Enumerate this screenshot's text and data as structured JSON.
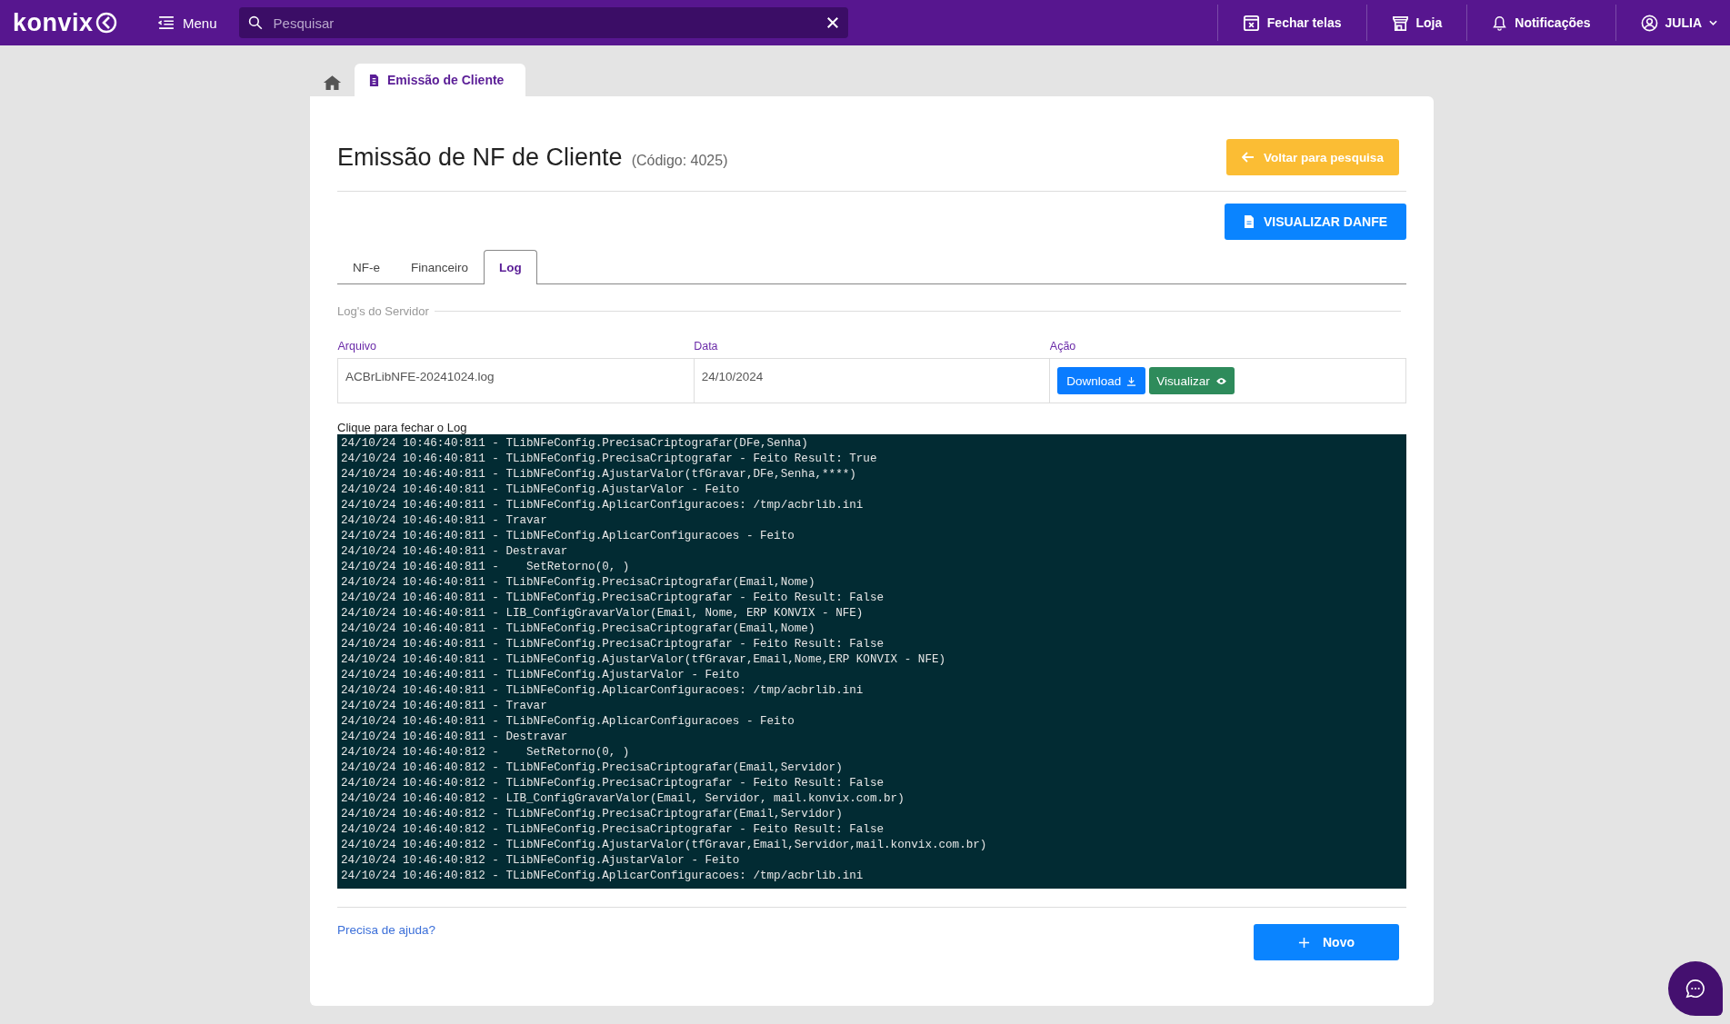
{
  "topbar": {
    "logo": "konvix",
    "menu_label": "Menu",
    "search": {
      "placeholder": "Pesquisar"
    },
    "actions": [
      {
        "kind": "close-screens",
        "label": "Fechar telas"
      },
      {
        "kind": "store",
        "label": "Loja"
      },
      {
        "kind": "bell",
        "label": "Notificações"
      },
      {
        "kind": "user",
        "label": "JULIA"
      }
    ]
  },
  "page_tabs": [
    {
      "label": "Emissão de Cliente",
      "selected": true
    }
  ],
  "title": "Emissão de NF de Cliente",
  "code": "(Código: 4025)",
  "back_button": "Voltar para pesquisa",
  "danfe_button": "VISUALIZAR DANFE",
  "tabs": [
    {
      "label": "NF-e",
      "selected": false
    },
    {
      "label": "Financeiro",
      "selected": false
    },
    {
      "label": "Log",
      "selected": true
    }
  ],
  "section_title": "Log's do Servidor",
  "table": {
    "columns": [
      "Arquivo",
      "Data",
      "Ação"
    ],
    "rows": [
      {
        "file": "ACBrLibNFE-20241024.log",
        "date": "24/10/2024",
        "download": "Download",
        "view": "Visualizar"
      }
    ]
  },
  "log_toggle": "Clique para fechar o Log",
  "log_lines": [
    "24/10/24 10:46:40:811 - TLibNFeConfig.PrecisaCriptografar(DFe,Senha)",
    "24/10/24 10:46:40:811 - TLibNFeConfig.PrecisaCriptografar - Feito Result: True",
    "24/10/24 10:46:40:811 - TLibNFeConfig.AjustarValor(tfGravar,DFe,Senha,****)",
    "24/10/24 10:46:40:811 - TLibNFeConfig.AjustarValor - Feito",
    "24/10/24 10:46:40:811 - TLibNFeConfig.AplicarConfiguracoes: /tmp/acbrlib.ini",
    "24/10/24 10:46:40:811 - Travar",
    "24/10/24 10:46:40:811 - TLibNFeConfig.AplicarConfiguracoes - Feito",
    "24/10/24 10:46:40:811 - Destravar",
    "24/10/24 10:46:40:811 -    SetRetorno(0, )",
    "24/10/24 10:46:40:811 - TLibNFeConfig.PrecisaCriptografar(Email,Nome)",
    "24/10/24 10:46:40:811 - TLibNFeConfig.PrecisaCriptografar - Feito Result: False",
    "24/10/24 10:46:40:811 - LIB_ConfigGravarValor(Email, Nome, ERP KONVIX - NFE)",
    "24/10/24 10:46:40:811 - TLibNFeConfig.PrecisaCriptografar(Email,Nome)",
    "24/10/24 10:46:40:811 - TLibNFeConfig.PrecisaCriptografar - Feito Result: False",
    "24/10/24 10:46:40:811 - TLibNFeConfig.AjustarValor(tfGravar,Email,Nome,ERP KONVIX - NFE)",
    "24/10/24 10:46:40:811 - TLibNFeConfig.AjustarValor - Feito",
    "24/10/24 10:46:40:811 - TLibNFeConfig.AplicarConfiguracoes: /tmp/acbrlib.ini",
    "24/10/24 10:46:40:811 - Travar",
    "24/10/24 10:46:40:811 - TLibNFeConfig.AplicarConfiguracoes - Feito",
    "24/10/24 10:46:40:811 - Destravar",
    "24/10/24 10:46:40:812 -    SetRetorno(0, )",
    "24/10/24 10:46:40:812 - TLibNFeConfig.PrecisaCriptografar(Email,Servidor)",
    "24/10/24 10:46:40:812 - TLibNFeConfig.PrecisaCriptografar - Feito Result: False",
    "24/10/24 10:46:40:812 - LIB_ConfigGravarValor(Email, Servidor, mail.konvix.com.br)",
    "24/10/24 10:46:40:812 - TLibNFeConfig.PrecisaCriptografar(Email,Servidor)",
    "24/10/24 10:46:40:812 - TLibNFeConfig.PrecisaCriptografar - Feito Result: False",
    "24/10/24 10:46:40:812 - TLibNFeConfig.AjustarValor(tfGravar,Email,Servidor,mail.konvix.com.br)",
    "24/10/24 10:46:40:812 - TLibNFeConfig.AjustarValor - Feito",
    "24/10/24 10:46:40:812 - TLibNFeConfig.AplicarConfiguracoes: /tmp/acbrlib.ini"
  ],
  "help_link": "Precisa de ajuda?",
  "new_button": "Novo"
}
